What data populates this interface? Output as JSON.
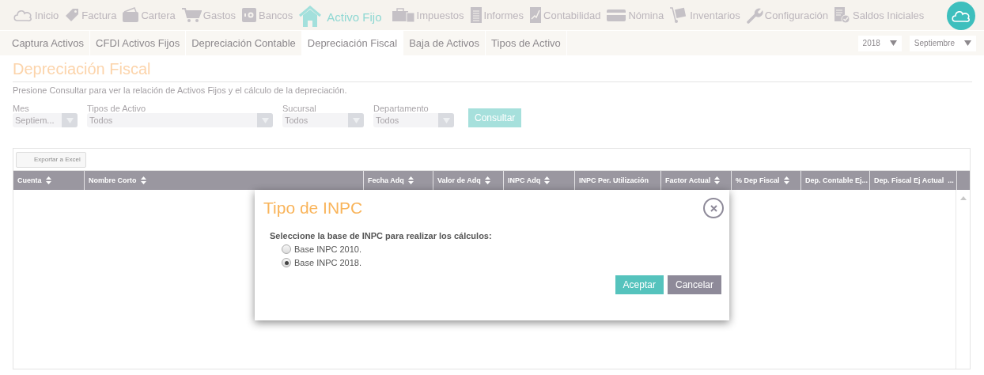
{
  "nav": [
    {
      "label": "Inicio",
      "selected": false
    },
    {
      "label": "Factura",
      "selected": false
    },
    {
      "label": "Cartera",
      "selected": false
    },
    {
      "label": "Gastos",
      "selected": false
    },
    {
      "label": "Bancos",
      "selected": false
    },
    {
      "label": "Activo Fijo",
      "selected": true
    },
    {
      "label": "Impuestos",
      "selected": false
    },
    {
      "label": "Informes",
      "selected": false
    },
    {
      "label": "Contabilidad",
      "selected": false
    },
    {
      "label": "Nómina",
      "selected": false
    },
    {
      "label": "Inventarios",
      "selected": false
    },
    {
      "label": "Configuración",
      "selected": false
    },
    {
      "label": "Saldos Iniciales",
      "selected": false
    }
  ],
  "subtabs": [
    {
      "label": "Captura Activos",
      "selected": false
    },
    {
      "label": "CFDI Activos Fijos",
      "selected": false
    },
    {
      "label": "Depreciación Contable",
      "selected": false
    },
    {
      "label": "Depreciación Fiscal",
      "selected": true
    },
    {
      "label": "Baja de Activos",
      "selected": false
    },
    {
      "label": "Tipos de Activo",
      "selected": false
    }
  ],
  "year_select": {
    "value": "2018"
  },
  "month_select": {
    "value": "Septiembre"
  },
  "page_title": "Depreciación Fiscal",
  "instructions": "Presione Consultar para ver la relación de Activos Fijos y el cálculo de la depreciación.",
  "filters": [
    {
      "label": "Mes",
      "value": "Septiem..."
    },
    {
      "label": "Tipos de Activo",
      "value": "Todos"
    },
    {
      "label": "Sucursal",
      "value": "Todos"
    },
    {
      "label": "Departamento",
      "value": "Todos"
    }
  ],
  "consult_button": "Consultar",
  "export_button": "Exportar a Excel",
  "table": {
    "columns": [
      {
        "label": "Cuenta",
        "sortable": true
      },
      {
        "label": "Nombre Corto",
        "sortable": true
      },
      {
        "label": "Fecha Adq",
        "sortable": true
      },
      {
        "label": "Valor de Adq",
        "sortable": true
      },
      {
        "label": "INPC Adq",
        "sortable": true
      },
      {
        "label": "INPC Per. Utilización",
        "sortable": false
      },
      {
        "label": "Factor Actual",
        "sortable": true
      },
      {
        "label": "% Dep Fiscal",
        "sortable": true
      },
      {
        "label": "Dep. Contable Ej..."
      },
      {
        "label": "Dep. Fiscal Ej Actual",
        "sortable": false,
        "trail": "..."
      }
    ]
  },
  "dialog": {
    "title": "Tipo de INPC",
    "prompt": "Seleccione la base de INPC para realizar los cálculos:",
    "options": [
      {
        "label": "Base INPC 2010.",
        "selected": false
      },
      {
        "label": "Base INPC 2018.",
        "selected": true
      }
    ],
    "buttons": [
      {
        "label": "Aceptar",
        "kind": "primary"
      },
      {
        "label": "Cancelar",
        "kind": "secondary"
      }
    ]
  }
}
